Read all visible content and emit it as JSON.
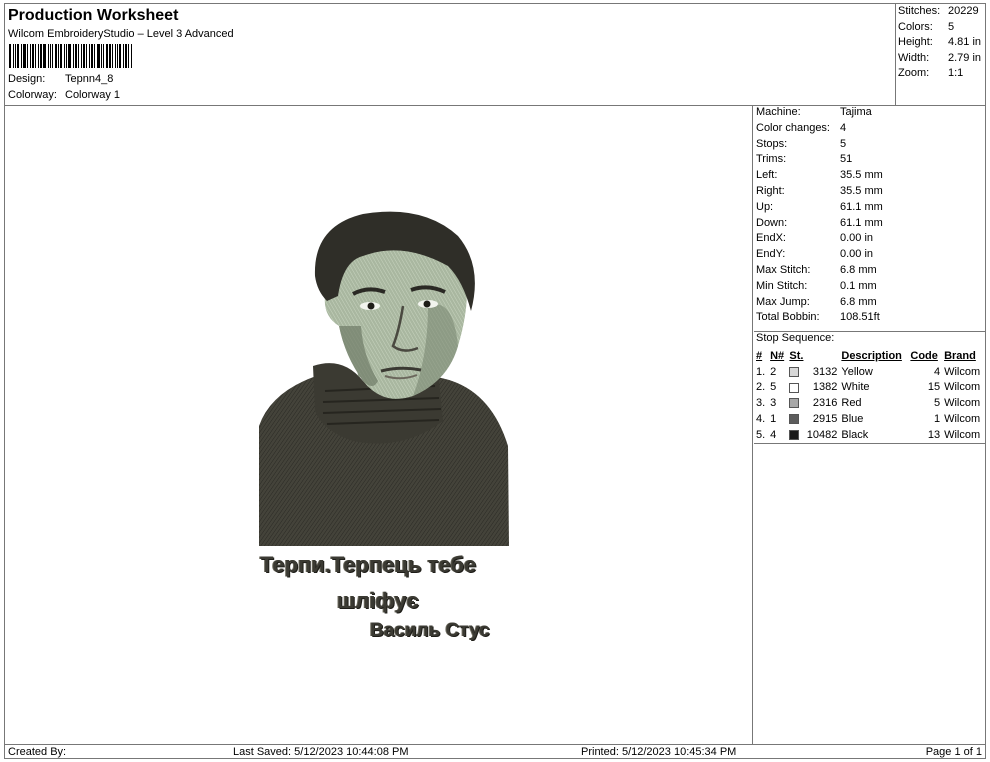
{
  "header": {
    "title": "Production Worksheet",
    "subtitle": "Wilcom EmbroideryStudio – Level 3 Advanced",
    "design_label": "Design:",
    "design_value": "Tepnn4_8",
    "colorway_label": "Colorway:",
    "colorway_value": "Colorway 1"
  },
  "stats": [
    {
      "label": "Stitches:",
      "value": "20229"
    },
    {
      "label": "Colors:",
      "value": "5"
    },
    {
      "label": "Height:",
      "value": "4.81 in"
    },
    {
      "label": "Width:",
      "value": "2.79 in"
    },
    {
      "label": "Zoom:",
      "value": "1:1"
    }
  ],
  "machine_info": [
    {
      "label": "Machine:",
      "value": "Tajima"
    },
    {
      "label": "Color changes:",
      "value": "4"
    },
    {
      "label": "Stops:",
      "value": "5"
    },
    {
      "label": "Trims:",
      "value": "51"
    },
    {
      "label": "Left:",
      "value": "35.5 mm"
    },
    {
      "label": "Right:",
      "value": "35.5 mm"
    },
    {
      "label": "Up:",
      "value": "61.1 mm"
    },
    {
      "label": "Down:",
      "value": "61.1 mm"
    },
    {
      "label": "EndX:",
      "value": "0.00 in"
    },
    {
      "label": "EndY:",
      "value": "0.00 in"
    },
    {
      "label": "Max Stitch:",
      "value": "6.8 mm"
    },
    {
      "label": "Min Stitch:",
      "value": "0.1 mm"
    },
    {
      "label": "Max Jump:",
      "value": "6.8 mm"
    },
    {
      "label": "Total Bobbin:",
      "value": "108.51ft"
    }
  ],
  "stop_sequence": {
    "title": "Stop Sequence:",
    "columns": [
      "#",
      "N#",
      "St.",
      "Description",
      "Code",
      "Brand"
    ],
    "rows": [
      {
        "idx": "1.",
        "n": "2",
        "color": "#d8d8d8",
        "st": "3132",
        "desc": "Yellow",
        "code": "4",
        "brand": "Wilcom"
      },
      {
        "idx": "2.",
        "n": "5",
        "color": "#ffffff",
        "st": "1382",
        "desc": "White",
        "code": "15",
        "brand": "Wilcom"
      },
      {
        "idx": "3.",
        "n": "3",
        "color": "#a8a8a8",
        "st": "2316",
        "desc": "Red",
        "code": "5",
        "brand": "Wilcom"
      },
      {
        "idx": "4.",
        "n": "1",
        "color": "#5c5c5c",
        "st": "2915",
        "desc": "Blue",
        "code": "1",
        "brand": "Wilcom"
      },
      {
        "idx": "5.",
        "n": "4",
        "color": "#1a1a1a",
        "st": "10482",
        "desc": "Black",
        "code": "13",
        "brand": "Wilcom"
      }
    ]
  },
  "design_text": {
    "line1": "Терпи.Терпець тебе",
    "line2": "шліфує",
    "line3": "Василь Стус"
  },
  "footer": {
    "created_by": "Created By:",
    "last_saved": "Last Saved: 5/12/2023 10:44:08 PM",
    "printed": "Printed: 5/12/2023 10:45:34 PM",
    "page": "Page 1 of 1"
  }
}
